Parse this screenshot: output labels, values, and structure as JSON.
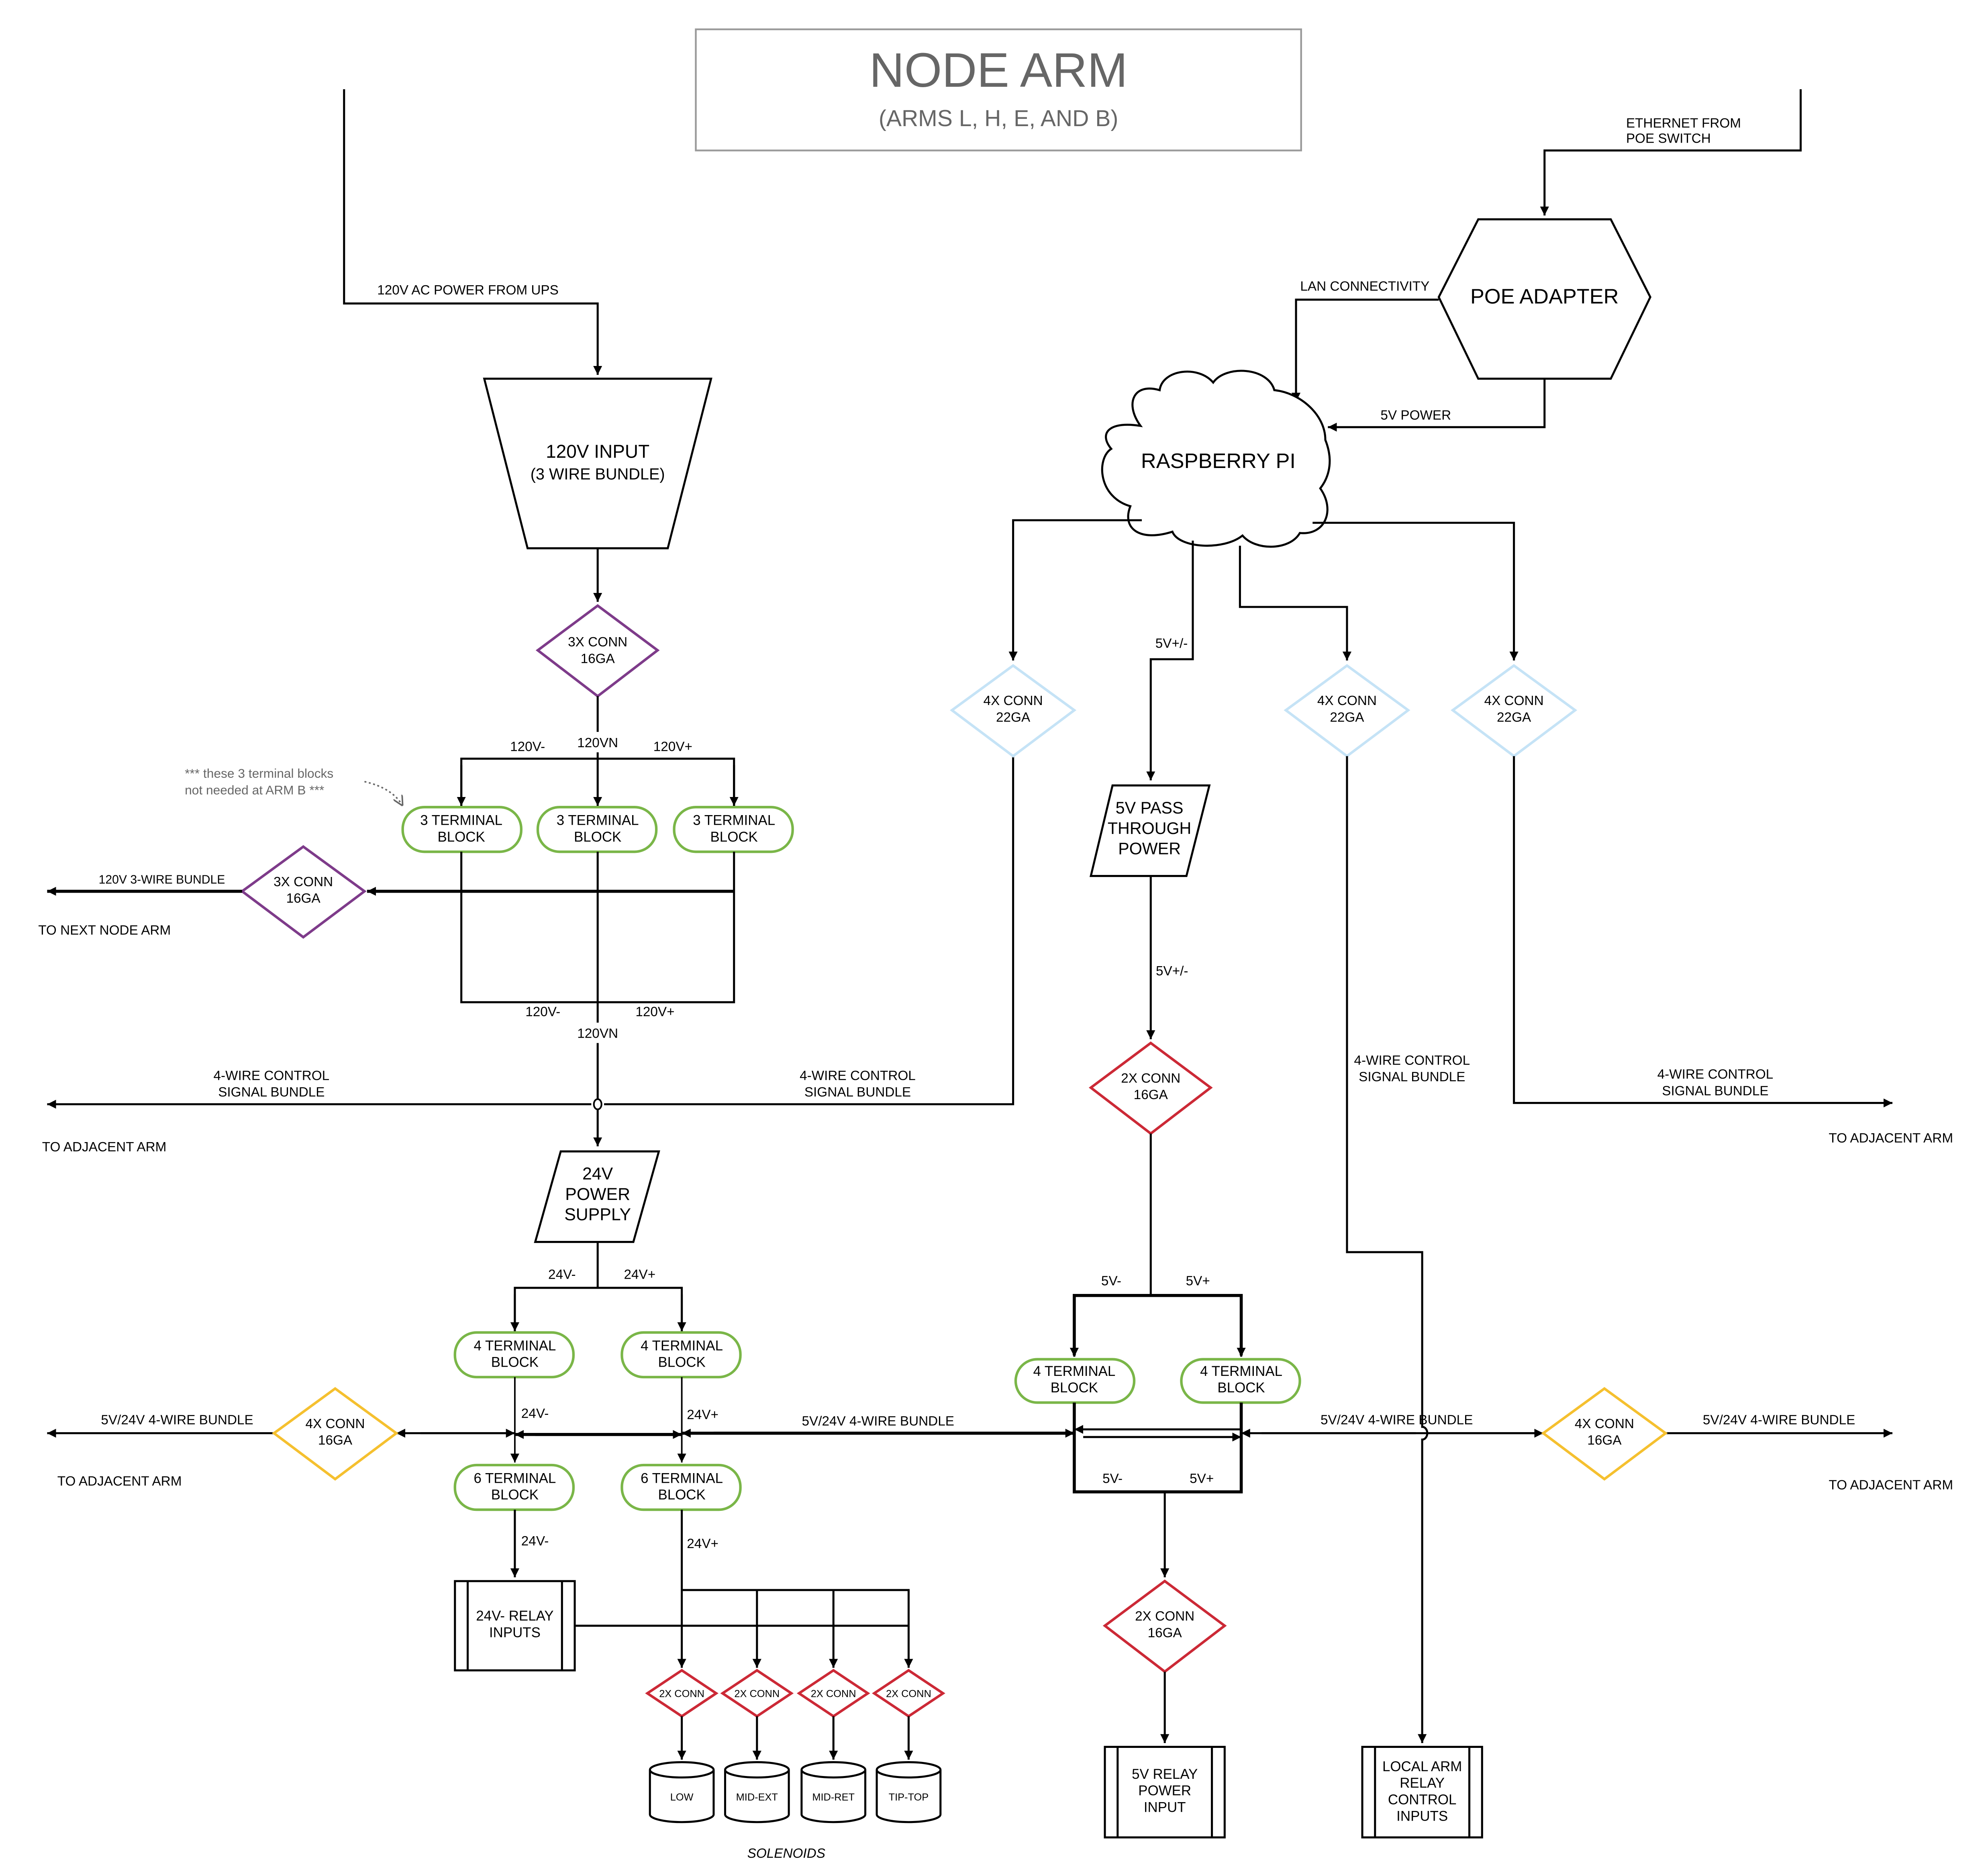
{
  "title": {
    "main": "NODE ARM",
    "sub": "(ARMS L, H, E, AND B)"
  },
  "colors": {
    "connector_3x": "#7e3b8a",
    "connector_4x_22ga": "#c5e3f6",
    "connector_2x": "#cc2936",
    "connector_4x_16ga": "#f5c02f",
    "terminal_block": "#7ab648",
    "title_text": "#666666"
  },
  "inputs": {
    "ac_power": "120V AC POWER FROM UPS",
    "ethernet_line1": "ETHERNET FROM",
    "ethernet_line2": "POE SWITCH"
  },
  "nodes": {
    "input_120v": {
      "line1": "120V INPUT",
      "line2": "(3 WIRE BUNDLE)"
    },
    "poe_adapter": {
      "label": "POE ADAPTER"
    },
    "raspberry_pi": {
      "label": "RASPBERRY PI"
    },
    "conn_3x_top": {
      "line1": "3X CONN",
      "line2": "16GA"
    },
    "conn_3x_left": {
      "line1": "3X CONN",
      "line2": "16GA"
    },
    "terminal_3": [
      {
        "line1": "3 TERMINAL",
        "line2": "BLOCK"
      },
      {
        "line1": "3 TERMINAL",
        "line2": "BLOCK"
      },
      {
        "line1": "3 TERMINAL",
        "line2": "BLOCK"
      }
    ],
    "power_24v": {
      "line1": "24V",
      "line2": "POWER",
      "line3": "SUPPLY"
    },
    "terminal_4_left": [
      {
        "line1": "4 TERMINAL",
        "line2": "BLOCK"
      },
      {
        "line1": "4 TERMINAL",
        "line2": "BLOCK"
      }
    ],
    "terminal_6": [
      {
        "line1": "6 TERMINAL",
        "line2": "BLOCK"
      },
      {
        "line1": "6 TERMINAL",
        "line2": "BLOCK"
      }
    ],
    "conn_4x_16_left": {
      "line1": "4X CONN",
      "line2": "16GA"
    },
    "conn_4x_16_right": {
      "line1": "4X CONN",
      "line2": "16GA"
    },
    "relay_24v": {
      "line1": "24V- RELAY",
      "line2": "INPUTS"
    },
    "solenoid_conns": [
      "2X CONN",
      "2X CONN",
      "2X CONN",
      "2X CONN"
    ],
    "solenoids": [
      "LOW",
      "MID-EXT",
      "MID-RET",
      "TIP-TOP"
    ],
    "solenoids_caption": "SOLENOIDS",
    "conn_4x_22": [
      {
        "line1": "4X CONN",
        "line2": "22GA"
      },
      {
        "line1": "4X CONN",
        "line2": "22GA"
      },
      {
        "line1": "4X CONN",
        "line2": "22GA"
      }
    ],
    "passthrough_5v": {
      "line1": "5V PASS",
      "line2": "THROUGH",
      "line3": "POWER"
    },
    "conn_2x_16_top": {
      "line1": "2X CONN",
      "line2": "16GA"
    },
    "conn_2x_16_bottom": {
      "line1": "2X CONN",
      "line2": "16GA"
    },
    "terminal_4_right": [
      {
        "line1": "4 TERMINAL",
        "line2": "BLOCK"
      },
      {
        "line1": "4 TERMINAL",
        "line2": "BLOCK"
      }
    ],
    "relay_5v": {
      "line1": "5V RELAY",
      "line2": "POWER",
      "line3": "INPUT"
    },
    "local_relay": {
      "line1": "LOCAL ARM",
      "line2": "RELAY",
      "line3": "CONTROL",
      "line4": "INPUTS"
    }
  },
  "labels": {
    "lan": "LAN CONNECTIVITY",
    "power_5v": "5V POWER",
    "v120_minus": "120V-",
    "v120_n": "120VN",
    "v120_plus": "120V+",
    "v120_minus_2": "120V-",
    "v120_plus_2": "120V+",
    "v120_n_2": "120VN",
    "bundle_120v": "120V 3-WIRE BUNDLE",
    "to_next_node": "TO NEXT NODE ARM",
    "control_bundle_l1": "4-WIRE CONTROL",
    "control_bundle_l2": "SIGNAL BUNDLE",
    "to_adjacent": "TO ADJACENT ARM",
    "v24_minus": "24V-",
    "v24_plus": "24V+",
    "bundle_5v24v": "5V/24V 4-WIRE BUNDLE",
    "v5_pm": "5V+/-",
    "v5_minus": "5V-",
    "v5_plus": "5V+",
    "note_line1": "*** these 3 terminal blocks",
    "note_line2": "not needed at ARM B ***"
  }
}
